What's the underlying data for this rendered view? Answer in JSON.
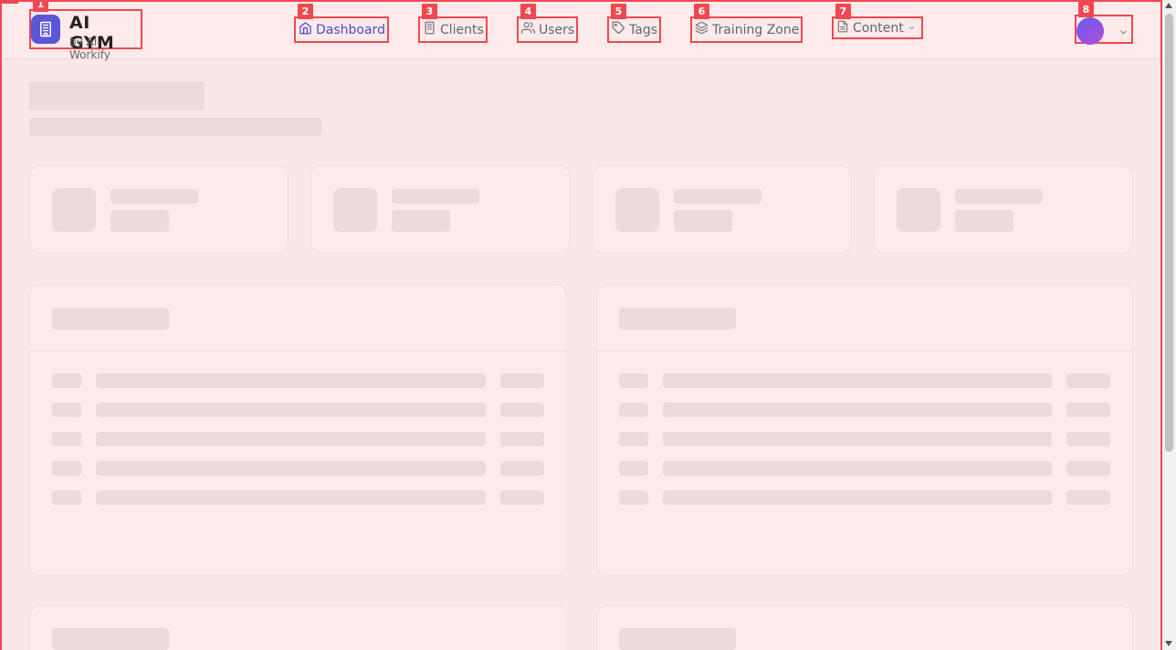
{
  "brand": {
    "title": "AI GYM",
    "subtitle": "by AI Workify",
    "logo_icon": "building-icon",
    "logo_color": "#5a57d6"
  },
  "nav": {
    "items": [
      {
        "label": "Dashboard",
        "icon": "home-icon",
        "badge": "2",
        "active": true
      },
      {
        "label": "Clients",
        "icon": "building-icon",
        "badge": "3"
      },
      {
        "label": "Users",
        "icon": "users-icon",
        "badge": "4"
      },
      {
        "label": "Tags",
        "icon": "tag-icon",
        "badge": "5"
      },
      {
        "label": "Training Zone",
        "icon": "layers-icon",
        "badge": "6"
      },
      {
        "label": "Content",
        "icon": "document-icon",
        "badge": "7",
        "has_dropdown": true
      }
    ]
  },
  "badges": {
    "brand": "1",
    "profile": "8"
  },
  "profile": {
    "avatar_icon": "avatar",
    "dropdown_icon": "chevron-down-icon"
  },
  "colors": {
    "accent": "#4a49c5",
    "highlight": "#f0484f",
    "background": "#fae8e8",
    "skeleton": "#eddbdc"
  }
}
